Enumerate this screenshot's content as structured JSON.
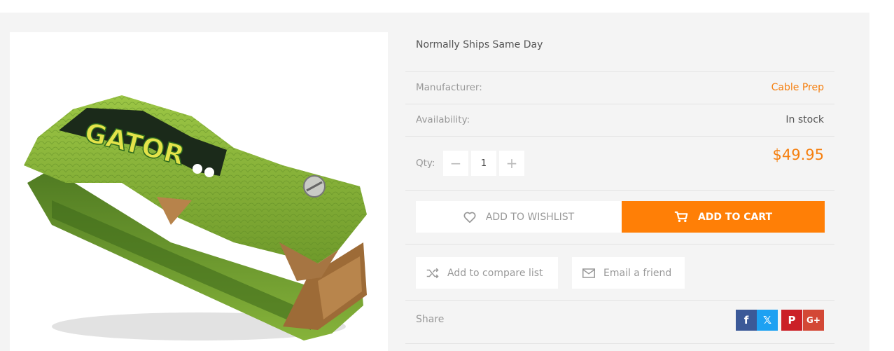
{
  "product": {
    "shipping_note": "Normally Ships Same Day",
    "manufacturer_label": "Manufacturer:",
    "manufacturer_value": "Cable Prep",
    "availability_label": "Availability:",
    "availability_value": "In stock",
    "qty_label": "Qty:",
    "qty_value": "1",
    "price": "$49.95",
    "image_text": "GATOR"
  },
  "actions": {
    "wishlist_label": "ADD TO WISHLIST",
    "cart_label": "ADD TO CART",
    "compare_label": "Add to compare list",
    "email_label": "Email a friend"
  },
  "share": {
    "label": "Share",
    "networks": [
      {
        "name": "facebook",
        "glyph": "f",
        "color": "#3b5998"
      },
      {
        "name": "x",
        "glyph": "𝕏",
        "color": "#1da1f2"
      },
      {
        "name": "pinterest",
        "glyph": "P",
        "color": "#cb2027"
      },
      {
        "name": "google-plus",
        "glyph": "G+",
        "color": "#d34836"
      }
    ]
  },
  "colors": {
    "accent": "#ff7f06",
    "price": "#f57f0f"
  }
}
